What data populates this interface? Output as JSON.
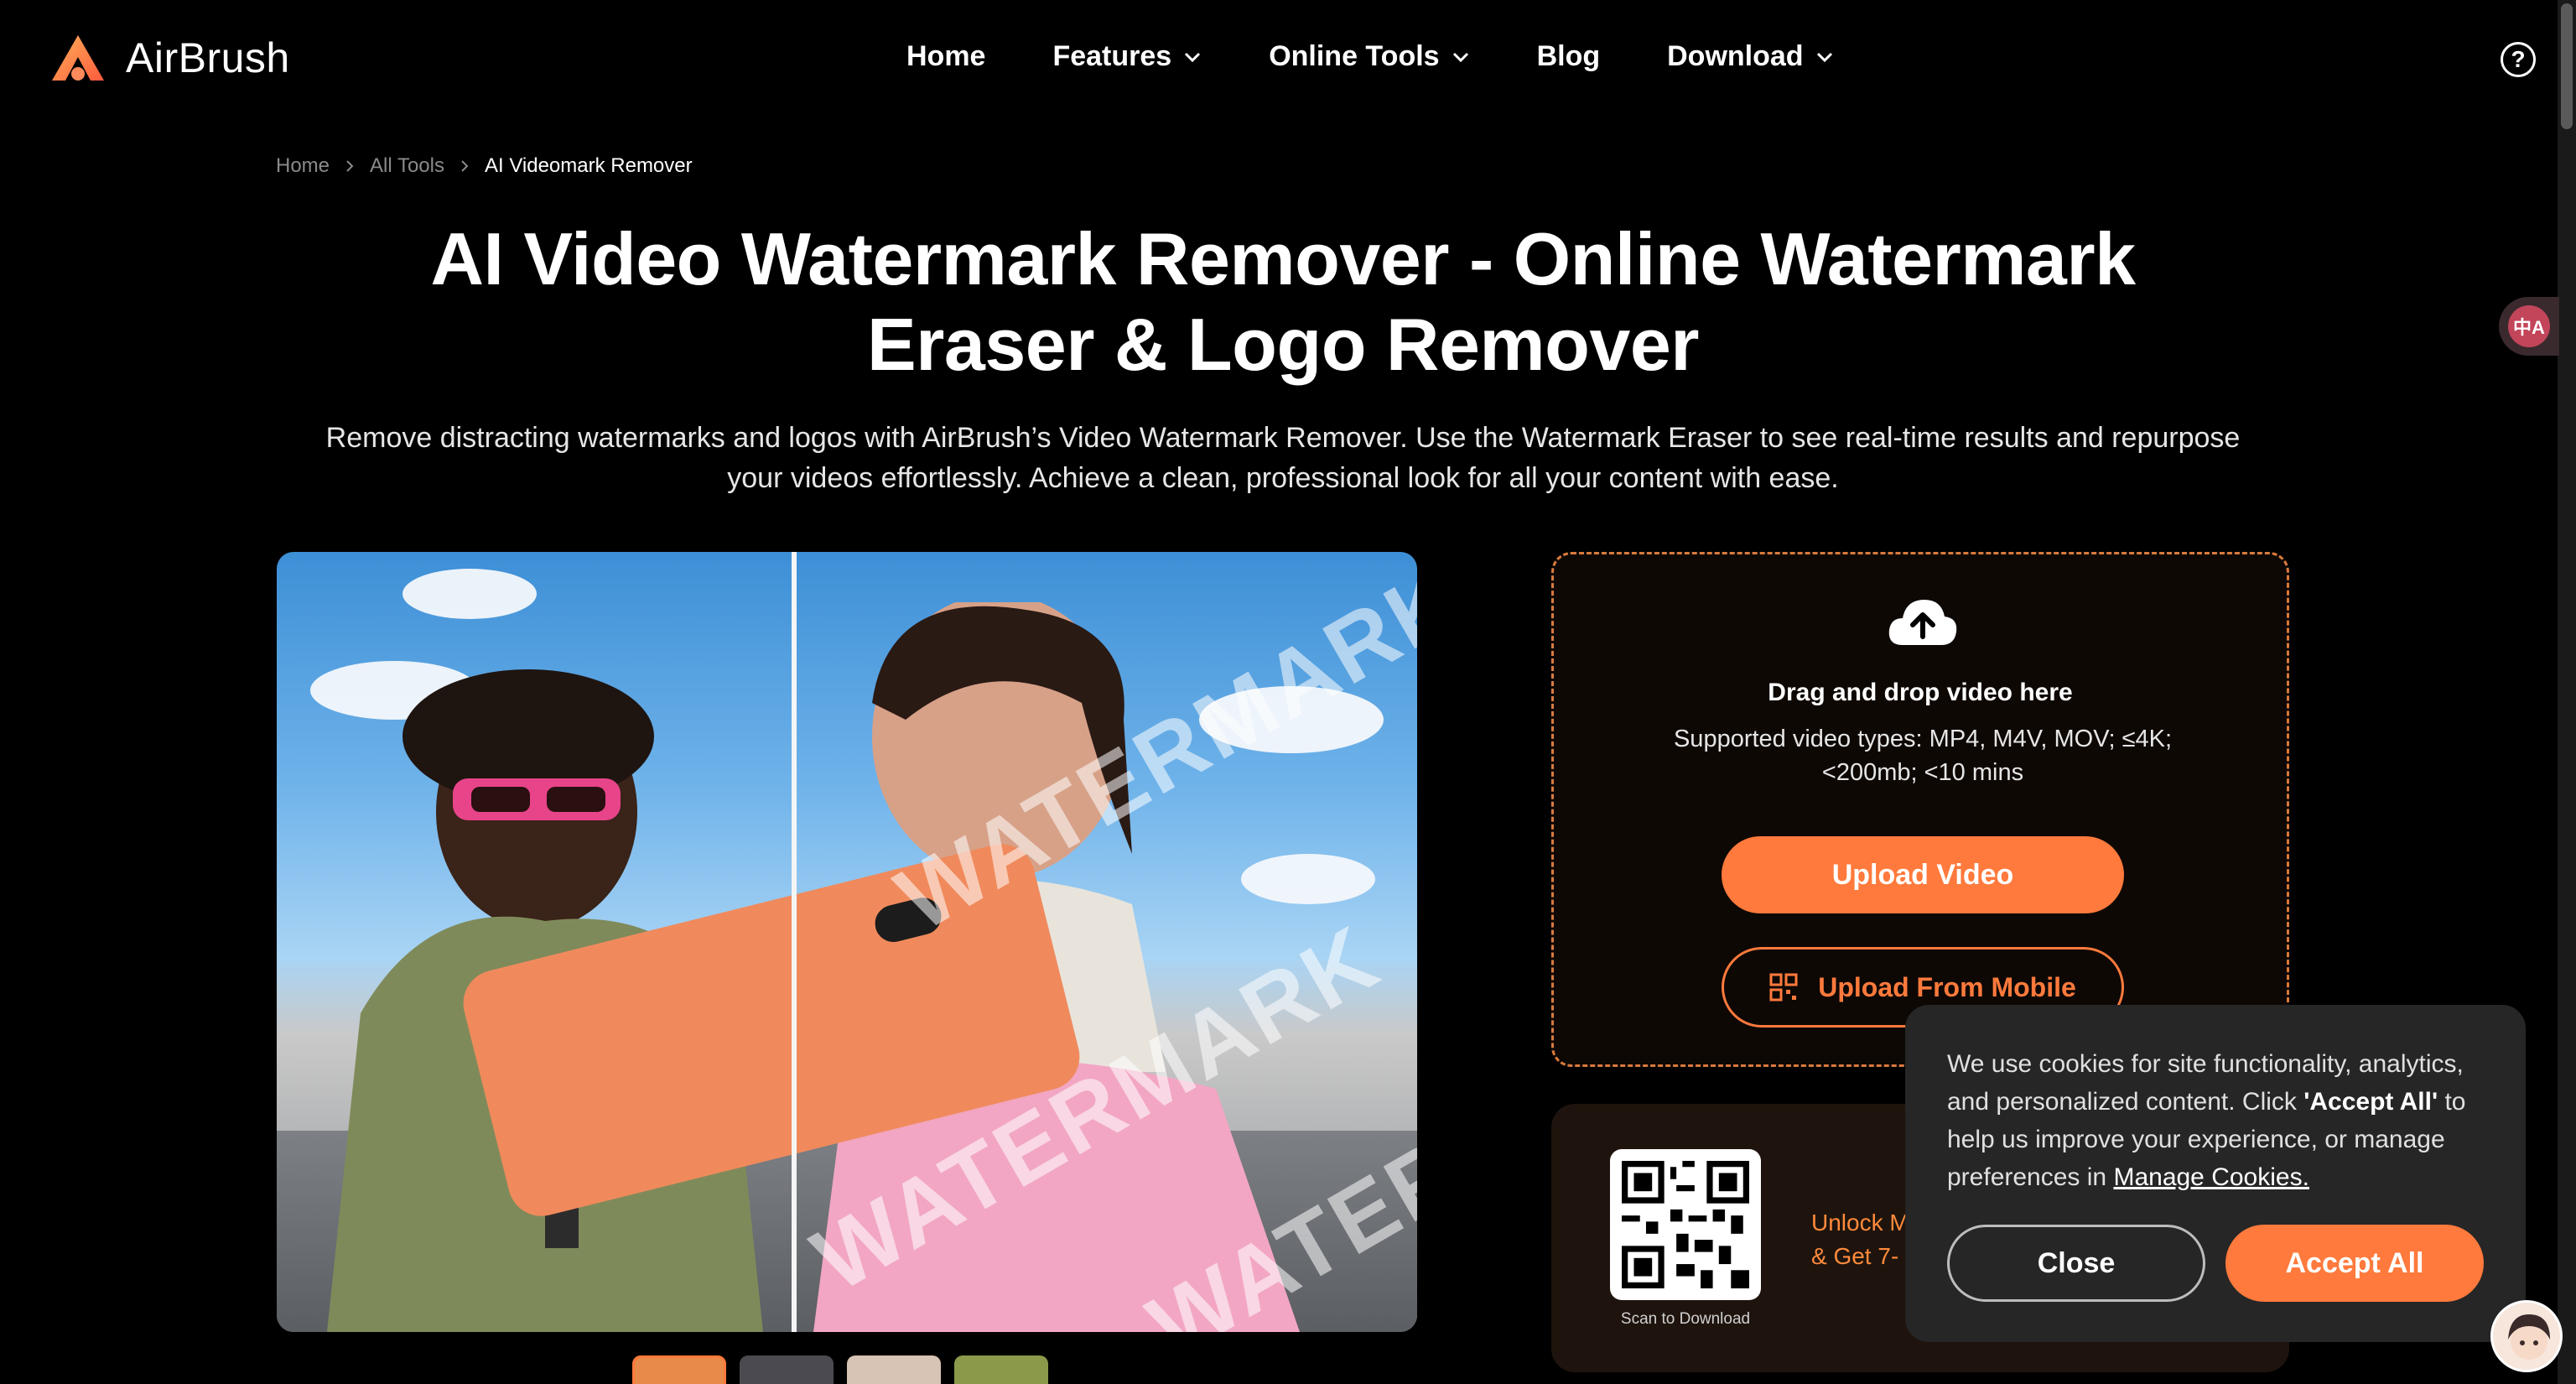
{
  "header": {
    "brand": "AirBrush",
    "nav": [
      {
        "label": "Home",
        "has_dropdown": false
      },
      {
        "label": "Features",
        "has_dropdown": true
      },
      {
        "label": "Online Tools",
        "has_dropdown": true
      },
      {
        "label": "Blog",
        "has_dropdown": false
      },
      {
        "label": "Download",
        "has_dropdown": true
      }
    ],
    "help_icon": "?"
  },
  "breadcrumb": {
    "items": [
      "Home",
      "All Tools",
      "AI Videomark Remover"
    ]
  },
  "hero": {
    "title_line1": "AI Video Watermark Remover - Online Watermark",
    "title_line2": "Eraser & Logo Remover",
    "subtitle_line1": "Remove distracting watermarks and logos with AirBrush’s Video Watermark Remover. Use the Watermark Eraser to see real-time results and repurpose",
    "subtitle_line2": "your videos effortlessly. Achieve a clean, professional look for all your content with ease."
  },
  "preview": {
    "watermark_text": "WATERMARK"
  },
  "upload": {
    "drag_text": "Drag and drop video here",
    "supported_line1": "Supported video types: MP4, M4V, MOV; ≤4K;",
    "supported_line2": "<200mb; <10 mins",
    "upload_button": "Upload Video",
    "mobile_button": "Upload From Mobile"
  },
  "promo": {
    "scan_text": "Scan to Download",
    "text_line1": "Unlock M",
    "text_line2": "& Get 7-"
  },
  "cookie": {
    "text_before": "We use cookies for site functionality, analytics, and personalized content. Click ",
    "accept_quote": "'Accept All'",
    "text_middle": " to help us improve your experience, or manage preferences in ",
    "manage_link": "Manage Cookies.",
    "close_button": "Close",
    "accept_button": "Accept All"
  },
  "widgets": {
    "translate_label": "中A"
  },
  "colors": {
    "accent": "#ff7a3c",
    "background": "#000000",
    "cookie_bg": "#262626"
  }
}
